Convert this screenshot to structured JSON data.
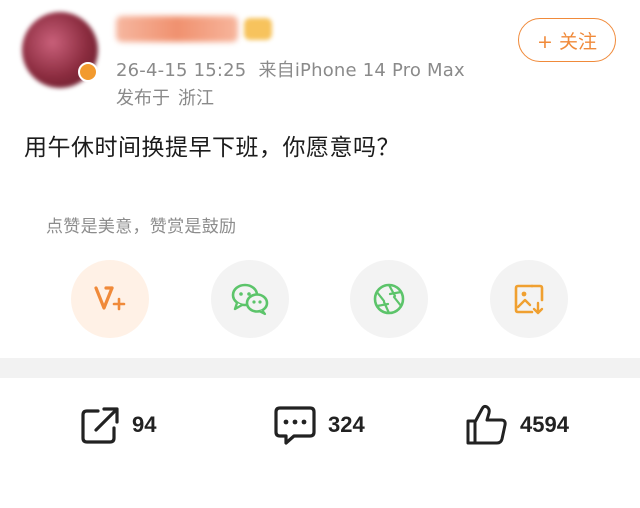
{
  "author": {
    "timestamp": "26-4-15 15:25",
    "source": "来自iPhone 14 Pro Max",
    "published_prefix": "发布于",
    "location": "浙江"
  },
  "follow_button": {
    "label": "+ 关注"
  },
  "post": {
    "text": "用午休时间换提早下班，你愿意吗？"
  },
  "reward_tip": "点赞是美意，赞赏是鼓励",
  "share_actions": [
    {
      "name": "reward",
      "icon": "reward-v-plus-icon",
      "color": "#f08a3a"
    },
    {
      "name": "wechat",
      "icon": "wechat-icon",
      "color": "#5cc46a"
    },
    {
      "name": "moments",
      "icon": "moments-aperture-icon",
      "color": "#5cc46a"
    },
    {
      "name": "save-image",
      "icon": "save-image-icon",
      "color": "#f0a030"
    }
  ],
  "stats": {
    "forward_count": "94",
    "comment_count": "324",
    "like_count": "4594"
  },
  "colors": {
    "accent": "#f08a3a",
    "muted": "#8a8a8a",
    "divider": "#f2f2f2"
  }
}
